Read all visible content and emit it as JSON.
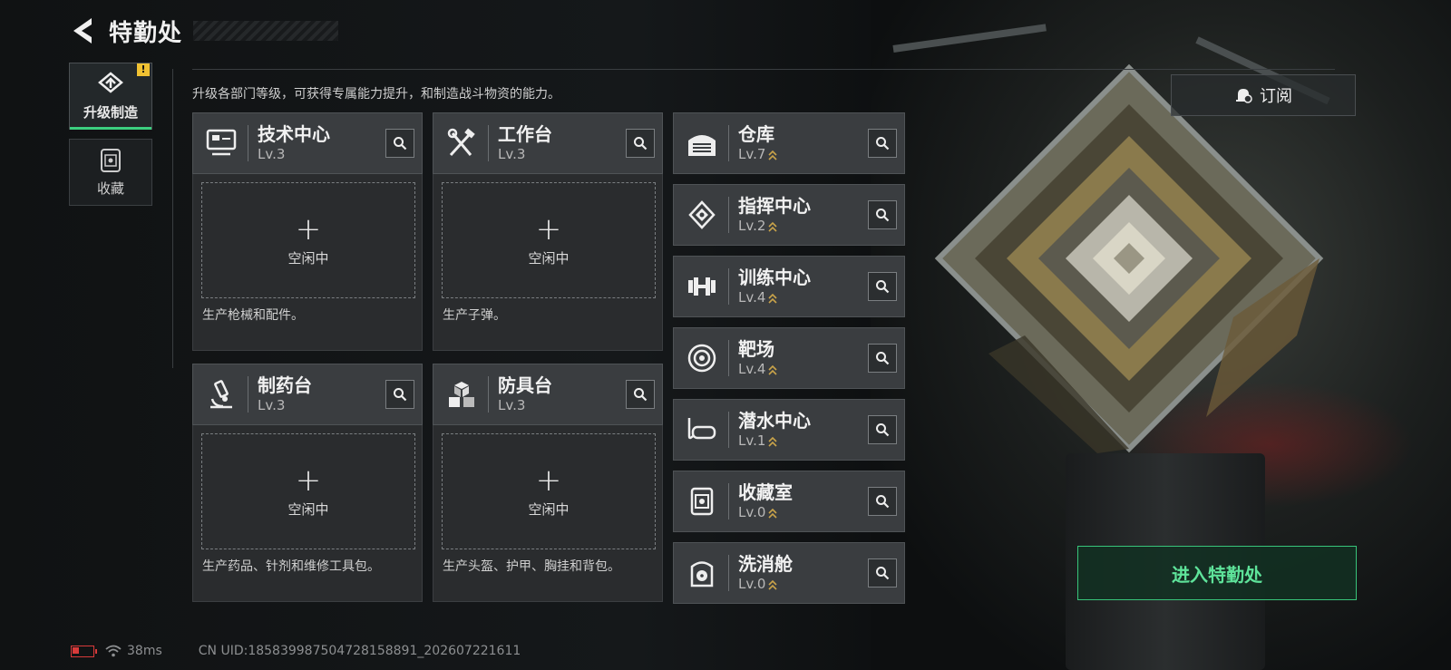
{
  "header": {
    "title": "特勤处"
  },
  "nav": [
    {
      "label": "升级制造",
      "active": true,
      "badge": "!"
    },
    {
      "label": "收藏",
      "active": false
    }
  ],
  "description": "升级各部门等级，可获得专属能力提升，和制造战斗物资的能力。",
  "stations": [
    {
      "name": "技术中心",
      "level": "Lv.3",
      "slot": "空闲中",
      "desc": "生产枪械和配件。",
      "icon": "computer-icon"
    },
    {
      "name": "工作台",
      "level": "Lv.3",
      "slot": "空闲中",
      "desc": "生产子弹。",
      "icon": "tools-icon"
    },
    {
      "name": "制药台",
      "level": "Lv.3",
      "slot": "空闲中",
      "desc": "生产药品、针剂和维修工具包。",
      "icon": "microscope-icon"
    },
    {
      "name": "防具台",
      "level": "Lv.3",
      "slot": "空闲中",
      "desc": "生产头盔、护甲、胸挂和背包。",
      "icon": "boxes-icon"
    }
  ],
  "facilities": [
    {
      "name": "仓库",
      "level": "Lv.7",
      "icon": "warehouse-icon"
    },
    {
      "name": "指挥中心",
      "level": "Lv.2",
      "icon": "chip-icon"
    },
    {
      "name": "训练中心",
      "level": "Lv.4",
      "icon": "dumbbell-icon"
    },
    {
      "name": "靶场",
      "level": "Lv.4",
      "icon": "target-icon"
    },
    {
      "name": "潜水中心",
      "level": "Lv.1",
      "icon": "dive-mask-icon"
    },
    {
      "name": "收藏室",
      "level": "Lv.0",
      "icon": "collection-icon"
    },
    {
      "name": "洗消舱",
      "level": "Lv.0",
      "icon": "decon-icon"
    }
  ],
  "subscribe_label": "订阅",
  "enter_label": "进入特勤处",
  "status": {
    "ping": "38ms",
    "uid": "CN UID:1858399875047281588​91_202607221611"
  },
  "colors": {
    "accent": "#3ccf7f",
    "level_arrow": "#c9a34a",
    "warning": "#f1c232",
    "battery": "#d83a3a"
  }
}
